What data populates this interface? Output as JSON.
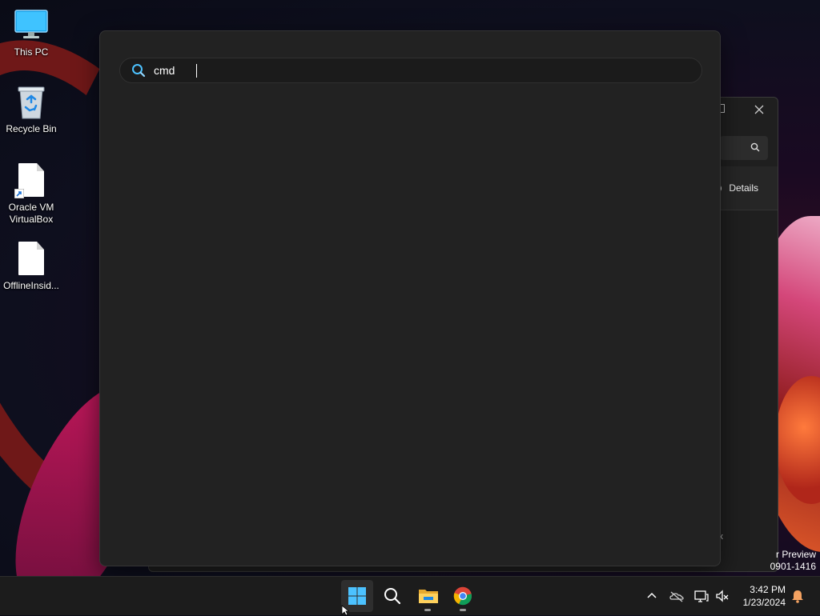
{
  "desktop": {
    "icons": [
      {
        "label": "This PC",
        "icon": "monitor-icon"
      },
      {
        "label": "Recycle Bin",
        "icon": "recycle-bin-icon"
      },
      {
        "label": "Oracle VM VirtualBox",
        "icon": "shortcut-file-icon"
      },
      {
        "label": "OfflineInsid...",
        "icon": "file-icon"
      }
    ]
  },
  "background_window": {
    "details_label": "Details",
    "status_fragment": "x"
  },
  "watermark": {
    "line1": "r Preview",
    "line2": "0901-1416"
  },
  "search": {
    "query": "cmd",
    "icon": "search-icon"
  },
  "taskbar": {
    "apps": [
      {
        "name": "Start",
        "icon": "windows-logo-icon"
      },
      {
        "name": "Search",
        "icon": "search-icon"
      },
      {
        "name": "File Explorer",
        "icon": "folder-icon"
      },
      {
        "name": "Google Chrome",
        "icon": "chrome-icon"
      }
    ],
    "tray_icons": [
      "chevron-up-icon",
      "onedrive-offline-icon",
      "network-icon",
      "volume-muted-icon",
      "notification-bell-icon"
    ],
    "clock": {
      "time": "3:42 PM",
      "date": "1/23/2024"
    }
  },
  "colors": {
    "accent": "#4cc2ff",
    "panel_bg": "#222222",
    "taskbar_bg": "#1c1c1c",
    "notification": "#f4a261"
  }
}
